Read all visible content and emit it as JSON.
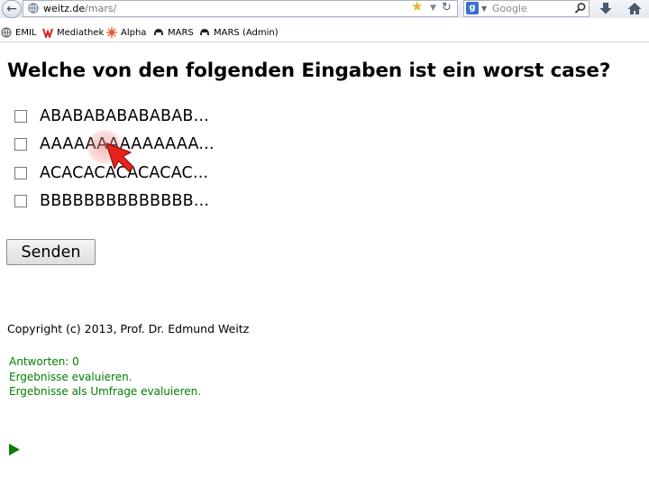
{
  "browser": {
    "url_host": "weitz.de",
    "url_path": "/mars/",
    "search_placeholder": "Google",
    "bookmarks": [
      {
        "label": "EMIL",
        "icon": "globe-icon"
      },
      {
        "label": "Mediathek",
        "icon": "mediathek-logo-icon"
      },
      {
        "label": "Alpha",
        "icon": "alpha-burst-icon"
      },
      {
        "label": "MARS",
        "icon": "mars-helmet-icon"
      },
      {
        "label": "MARS (Admin)",
        "icon": "mars-helmet-icon"
      }
    ]
  },
  "page": {
    "title": "Welche von den folgenden Eingaben ist ein worst case?",
    "options": [
      {
        "label": "ABABABABABABAB...",
        "checked": false
      },
      {
        "label": "AAAAAAAAAAAAAA...",
        "checked": false
      },
      {
        "label": "ACACACACACACAC...",
        "checked": false
      },
      {
        "label": "BBBBBBBBBBBBBB...",
        "checked": false
      }
    ],
    "submit_label": "Senden",
    "copyright": "Copyright (c) 2013, Prof. Dr. Edmund Weitz",
    "answers": "Antworten: 0",
    "evaluate_link": "Ergebnisse evaluieren.",
    "evaluate_survey_link": "Ergebnisse als Umfrage evaluieren."
  },
  "colors": {
    "link_green": "#008000",
    "cursor_red": "#e8231c"
  }
}
